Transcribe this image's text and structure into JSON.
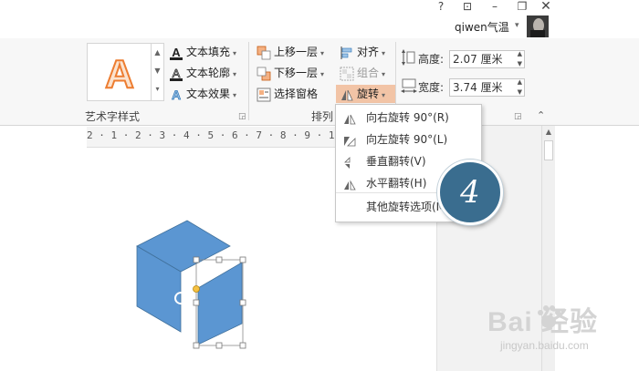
{
  "window": {
    "help": "?",
    "restore_ribbon": "⊡",
    "minimize": "–",
    "restore": "❐",
    "close": "✕"
  },
  "account": {
    "user_name": "qiwen气温",
    "dropdown": "▾"
  },
  "ribbon": {
    "wordart_group_label": "艺术字样式",
    "text_fill": "文本填充",
    "text_outline": "文本轮廓",
    "text_effects": "文本效果",
    "arrange_group_label": "排列",
    "bring_forward": "上移一层",
    "send_backward": "下移一层",
    "selection_pane": "选择窗格",
    "align": "对齐",
    "group": "组合",
    "rotate": "旋转",
    "height_label": "高度:",
    "height_value": "2.07 厘米",
    "width_label": "宽度:",
    "width_value": "3.74 厘米",
    "accent_color": "#f2c4a6"
  },
  "ruler": {
    "text": "2 · 1 · 2 · 3 · 4 · 5 · 6 · 7 · 8 · 9 · 10 · 11 · 12 ·"
  },
  "rotate_menu": {
    "items": [
      {
        "label": "向右旋转 90°(R)",
        "icon": "rotate-right-icon"
      },
      {
        "label": "向左旋转 90°(L)",
        "icon": "rotate-left-icon"
      },
      {
        "label": "垂直翻转(V)",
        "icon": "flip-vertical-icon"
      },
      {
        "label": "水平翻转(H)",
        "icon": "flip-horizontal-icon"
      },
      {
        "label": "其他旋转选项(M)...",
        "icon": ""
      }
    ]
  },
  "step_badge": "4",
  "watermark": {
    "brand": "Bai  经验",
    "url": "jingyan.baidu.com"
  },
  "colors": {
    "shape_blue": "#5b96d2",
    "shape_stroke": "#41719c",
    "badge": "#3a6d8f"
  }
}
